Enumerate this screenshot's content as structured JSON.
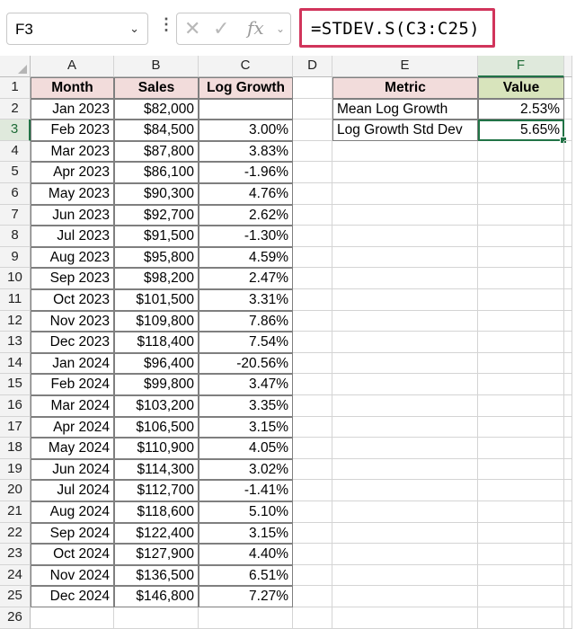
{
  "name_box": {
    "value": "F3"
  },
  "formula_bar": {
    "icons": [
      "vertical-dots-icon",
      "cancel-icon",
      "enter-check-icon",
      "insert-function-icon",
      "expand-chevron-icon"
    ],
    "fx_label": "fx",
    "formula": "=STDEV.S(C3:C25)"
  },
  "columns": [
    "A",
    "B",
    "C",
    "D",
    "E",
    "F"
  ],
  "selected_cell": {
    "column": "F",
    "row": 3
  },
  "table": {
    "headers": [
      "Month",
      "Sales",
      "Log Growth"
    ],
    "rows": [
      [
        "Jan 2023",
        "$82,000",
        ""
      ],
      [
        "Feb 2023",
        "$84,500",
        "3.00%"
      ],
      [
        "Mar 2023",
        "$87,800",
        "3.83%"
      ],
      [
        "Apr 2023",
        "$86,100",
        "-1.96%"
      ],
      [
        "May 2023",
        "$90,300",
        "4.76%"
      ],
      [
        "Jun 2023",
        "$92,700",
        "2.62%"
      ],
      [
        "Jul 2023",
        "$91,500",
        "-1.30%"
      ],
      [
        "Aug 2023",
        "$95,800",
        "4.59%"
      ],
      [
        "Sep 2023",
        "$98,200",
        "2.47%"
      ],
      [
        "Oct 2023",
        "$101,500",
        "3.31%"
      ],
      [
        "Nov 2023",
        "$109,800",
        "7.86%"
      ],
      [
        "Dec 2023",
        "$118,400",
        "7.54%"
      ],
      [
        "Jan 2024",
        "$96,400",
        "-20.56%"
      ],
      [
        "Feb 2024",
        "$99,800",
        "3.47%"
      ],
      [
        "Mar 2024",
        "$103,200",
        "3.35%"
      ],
      [
        "Apr 2024",
        "$106,500",
        "3.15%"
      ],
      [
        "May 2024",
        "$110,900",
        "4.05%"
      ],
      [
        "Jun 2024",
        "$114,300",
        "3.02%"
      ],
      [
        "Jul 2024",
        "$112,700",
        "-1.41%"
      ],
      [
        "Aug 2024",
        "$118,600",
        "5.10%"
      ],
      [
        "Sep 2024",
        "$122,400",
        "3.15%"
      ],
      [
        "Oct 2024",
        "$127,900",
        "4.40%"
      ],
      [
        "Nov 2024",
        "$136,500",
        "6.51%"
      ],
      [
        "Dec 2024",
        "$146,800",
        "7.27%"
      ]
    ]
  },
  "summary": {
    "headers": [
      "Metric",
      "Value"
    ],
    "rows": [
      [
        "Mean Log Growth",
        "2.53%"
      ],
      [
        "Log Growth Std Dev",
        "5.65%"
      ]
    ]
  },
  "colors": {
    "header_pink": "#f2dcdb",
    "header_green": "#d8e4bc",
    "selection_green": "#217346",
    "formula_highlight": "#d1345b"
  }
}
